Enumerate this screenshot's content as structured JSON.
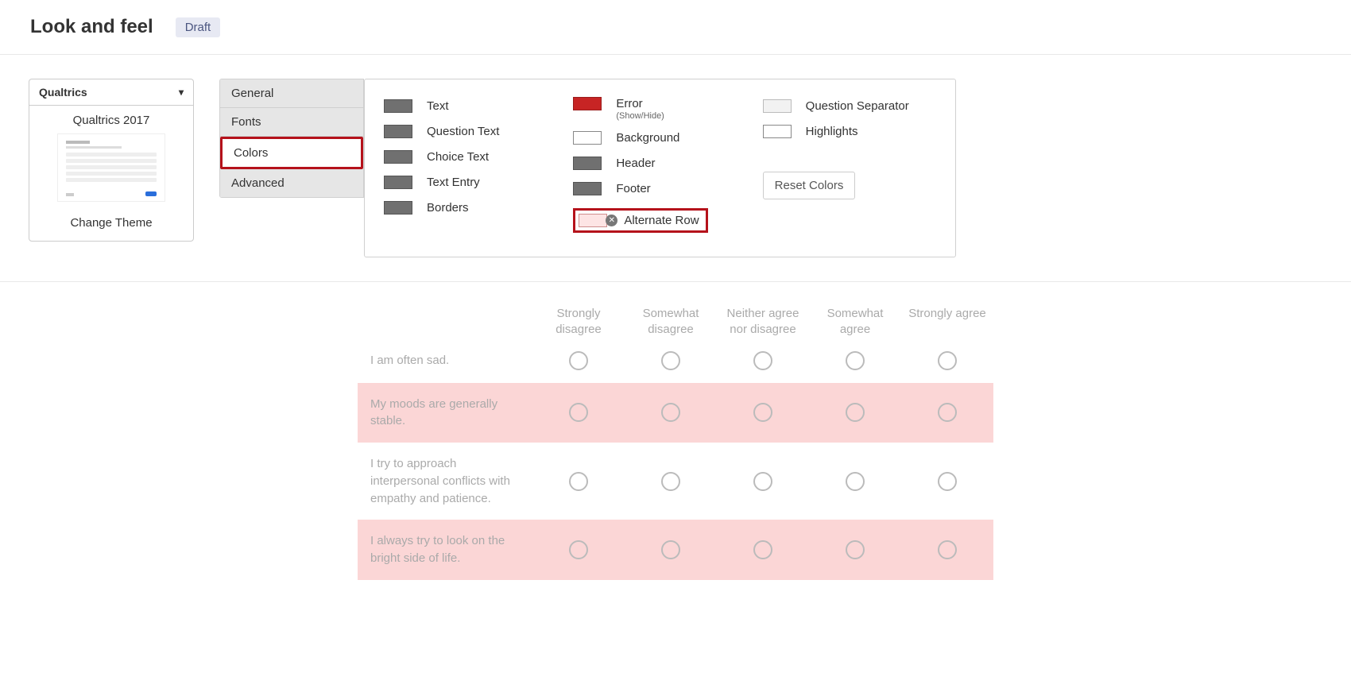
{
  "header": {
    "title": "Look and feel",
    "badge": "Draft"
  },
  "theme": {
    "dropdown_label": "Qualtrics",
    "current_name": "Qualtrics 2017",
    "change_label": "Change Theme"
  },
  "tabs": {
    "general": "General",
    "fonts": "Fonts",
    "colors": "Colors",
    "advanced": "Advanced"
  },
  "colors": {
    "col1": {
      "text": "Text",
      "question_text": "Question Text",
      "choice_text": "Choice Text",
      "text_entry": "Text Entry",
      "borders": "Borders"
    },
    "col2": {
      "error": "Error",
      "error_sub": "(Show/Hide)",
      "background": "Background",
      "header": "Header",
      "footer": "Footer",
      "alternate_row": "Alternate Row"
    },
    "col3": {
      "question_separator": "Question Separator",
      "highlights": "Highlights",
      "reset": "Reset Colors"
    }
  },
  "matrix": {
    "columns": [
      "Strongly disagree",
      "Somewhat disagree",
      "Neither agree nor disagree",
      "Somewhat agree",
      "Strongly agree"
    ],
    "rows": [
      "I am often sad.",
      "My moods are generally stable.",
      "I try to approach interpersonal conflicts with empathy and patience.",
      "I always try to look on the bright side of life."
    ]
  }
}
